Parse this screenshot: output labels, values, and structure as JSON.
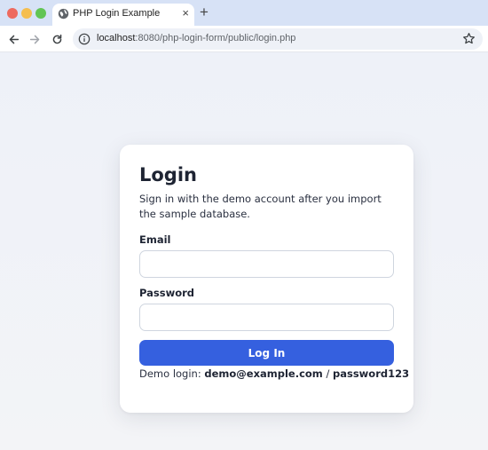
{
  "browser": {
    "tab_title": "PHP Login Example",
    "tab_close": "×",
    "new_tab": "+",
    "url_host": "localhost",
    "url_rest": ":8080/php-login-form/public/login.php"
  },
  "login": {
    "title": "Login",
    "subtitle": "Sign in with the demo account after you import the sample database.",
    "email_label": "Email",
    "email_value": "",
    "password_label": "Password",
    "password_value": "",
    "button_label": "Log In",
    "demo_prefix": "Demo login:",
    "demo_email": "demo@example.com",
    "demo_separator": "/",
    "demo_password": "password123"
  },
  "colors": {
    "accent": "#3560df",
    "tabbar": "#d7e2f6",
    "page_bg": "#eef1f8"
  },
  "icons": {
    "favicon": "globe-icon",
    "back": "back-arrow-icon",
    "forward": "forward-arrow-icon",
    "reload": "reload-icon",
    "site_info": "info-icon",
    "bookmark": "star-icon"
  }
}
